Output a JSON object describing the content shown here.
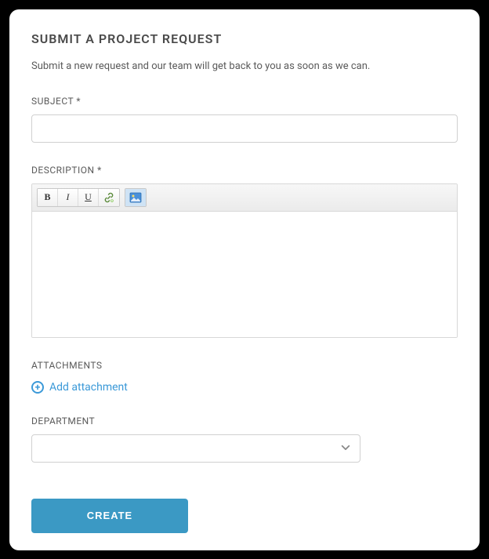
{
  "title": "SUBMIT A PROJECT REQUEST",
  "subtitle": "Submit a new request and our team will get back to you as soon as we can.",
  "subject": {
    "label": "SUBJECT *",
    "value": ""
  },
  "description": {
    "label": "DESCRIPTION *",
    "value": "",
    "toolbar": {
      "bold": "B",
      "italic": "I",
      "underline": "U",
      "link": "link",
      "image": "image"
    }
  },
  "attachments": {
    "label": "ATTACHMENTS",
    "add_label": "Add attachment"
  },
  "department": {
    "label": "DEPARTMENT",
    "value": ""
  },
  "submit_label": "CREATE"
}
